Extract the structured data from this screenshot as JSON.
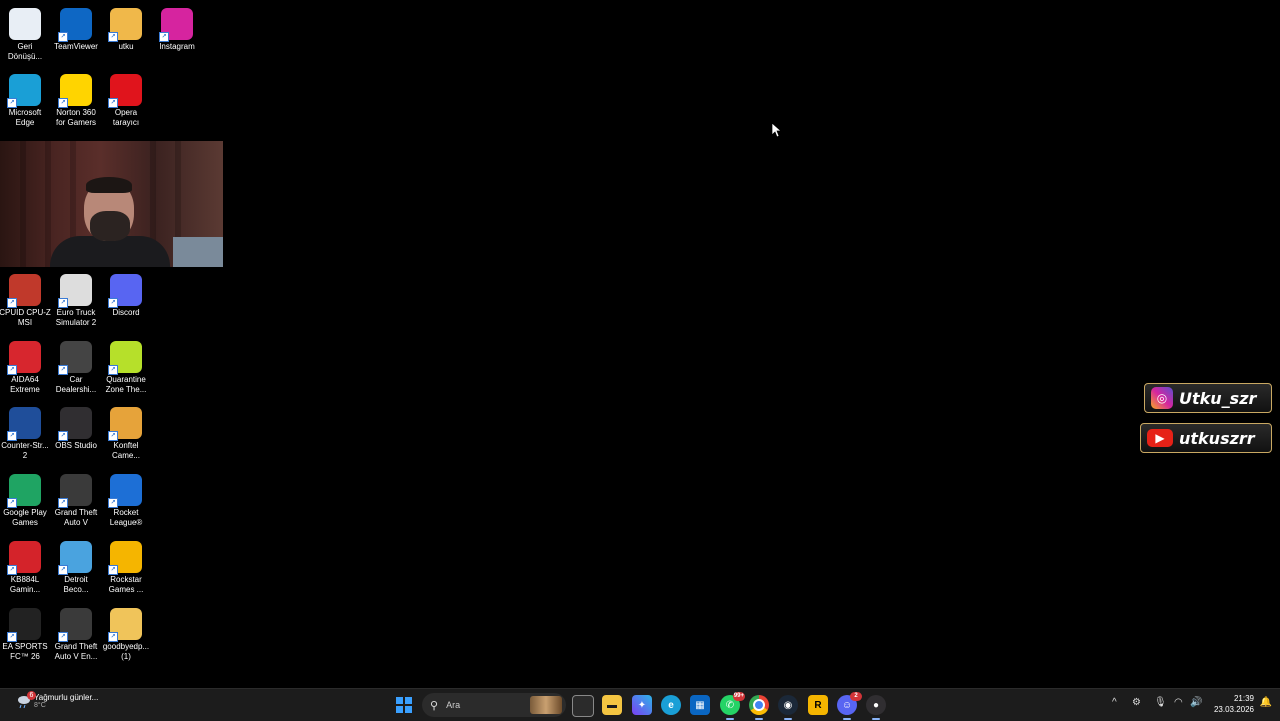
{
  "desktop": {
    "icons": [
      {
        "label": "Geri\nDönüşü...",
        "icon": "recycle-bin-icon",
        "color": "#e8eef5"
      },
      {
        "label": "TeamViewer",
        "icon": "teamviewer-icon",
        "color": "#0e67c4"
      },
      {
        "label": "utku",
        "icon": "folder-icon",
        "color": "#f0b84a"
      },
      {
        "label": "Instagram",
        "icon": "instagram-icon",
        "color": "#d6249f"
      },
      {
        "label": "Microsoft\nEdge",
        "icon": "edge-icon",
        "color": "#1a9fd6"
      },
      {
        "label": "Norton 360\nfor Gamers",
        "icon": "norton-icon",
        "color": "#ffd400"
      },
      {
        "label": "Opera\ntarayıcı",
        "icon": "opera-icon",
        "color": "#e0141c"
      },
      {
        "label": "CPUID CPU-Z\nMSI",
        "icon": "cpuz-icon",
        "color": "#c0392b"
      },
      {
        "label": "Euro Truck\nSimulator 2",
        "icon": "ets2-icon",
        "color": "#dddddd"
      },
      {
        "label": "Discord",
        "icon": "discord-icon",
        "color": "#5865f2"
      },
      {
        "label": "AIDA64\nExtreme",
        "icon": "aida64-icon",
        "color": "#d7262e"
      },
      {
        "label": "Car\nDealershi...",
        "icon": "car-dealership-icon",
        "color": "#444444"
      },
      {
        "label": "Quarantine\nZone The...",
        "icon": "quarantine-zone-icon",
        "color": "#b6e02a"
      },
      {
        "label": "Counter-Str...\n2",
        "icon": "counter-strike-icon",
        "color": "#1f4e9a"
      },
      {
        "label": "OBS Studio",
        "icon": "obs-icon",
        "color": "#302e31"
      },
      {
        "label": "Konftel\nCame...",
        "icon": "konftel-icon",
        "color": "#e6a33a"
      },
      {
        "label": "Google Play\nGames",
        "icon": "google-play-games-icon",
        "color": "#1fa463"
      },
      {
        "label": "Grand Theft\nAuto V",
        "icon": "gta5-icon",
        "color": "#3a3a3a"
      },
      {
        "label": "Rocket\nLeague®",
        "icon": "rocket-league-icon",
        "color": "#1d6fd6"
      },
      {
        "label": "KB884L\nGamin...",
        "icon": "kb884l-icon",
        "color": "#d4232a"
      },
      {
        "label": "Detroit\nBeco...",
        "icon": "detroit-icon",
        "color": "#4aa3df"
      },
      {
        "label": "Rockstar\nGames ...",
        "icon": "rockstar-icon",
        "color": "#f5b500"
      },
      {
        "label": "EA SPORTS\nFC™ 26",
        "icon": "ea-fc-icon",
        "color": "#222222"
      },
      {
        "label": "Grand Theft\nAuto V En...",
        "icon": "gta5-enhanced-icon",
        "color": "#3a3a3a"
      },
      {
        "label": "goodbyedp...\n(1)",
        "icon": "folder-icon",
        "color": "#f0c45a"
      }
    ]
  },
  "social": {
    "instagram": "Utku_szr",
    "youtube": "utkuszrr"
  },
  "taskbar": {
    "weather_title": "Yağmurlu günler...",
    "weather_temp": "8°C",
    "weather_badge": "6",
    "search_placeholder": "Ara",
    "whatsapp_badge": "99+",
    "discord_badge": "2",
    "time": "21:39",
    "date": "23.03.2026"
  }
}
